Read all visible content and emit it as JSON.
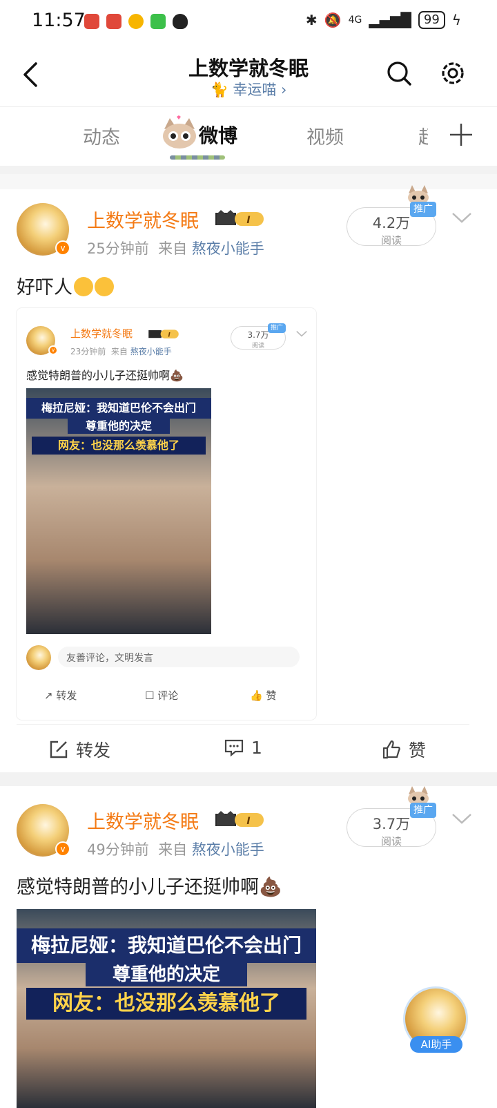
{
  "status_bar": {
    "time": "11:57",
    "battery": "99",
    "network": "4G"
  },
  "header": {
    "title": "上数学就冬眠",
    "subtitle": "幸运喵 ›"
  },
  "tabs": [
    {
      "label": "动态"
    },
    {
      "label": "微博"
    },
    {
      "label": "视频"
    },
    {
      "label": "超"
    }
  ],
  "post1": {
    "username": "上数学就冬眠",
    "level": "I",
    "time": "25分钟前",
    "source_prefix": "来自",
    "source": "熬夜小能手",
    "reads": "4.2万",
    "reads_label": "阅读",
    "promo": "推广",
    "text": "好吓人",
    "embed": {
      "username": "上数学就冬眠",
      "level": "I",
      "time": "23分钟前",
      "source_prefix": "来自",
      "source": "熬夜小能手",
      "reads": "3.7万",
      "reads_label": "阅读",
      "promo": "推广",
      "text": "感觉特朗普的小儿子还挺帅啊",
      "caption_top": "梅拉尼娅：我知道巴伦不会出门",
      "caption_mid": "尊重他的决定",
      "caption_bottom": "网友：也没那么羡慕他了",
      "comment_placeholder": "友善评论，文明发言",
      "repost": "转发",
      "comment": "评论",
      "like": "赞"
    },
    "actions": {
      "repost": "转发",
      "comment_count": "1",
      "like": "赞"
    }
  },
  "post2": {
    "username": "上数学就冬眠",
    "level": "I",
    "time": "49分钟前",
    "source_prefix": "来自",
    "source": "熬夜小能手",
    "reads": "3.7万",
    "reads_label": "阅读",
    "promo": "推广",
    "text": "感觉特朗普的小儿子还挺帅啊",
    "caption_top": "梅拉尼娅：我知道巴伦不会出门",
    "caption_mid": "尊重他的决定",
    "caption_bottom": "网友：也没那么羡慕他了"
  },
  "ai_button": {
    "label": "AI助手"
  },
  "colors": {
    "username": "#f47a14",
    "link": "#5b7ea8",
    "promo": "#5aa7f0",
    "vip": "#ff8200"
  }
}
